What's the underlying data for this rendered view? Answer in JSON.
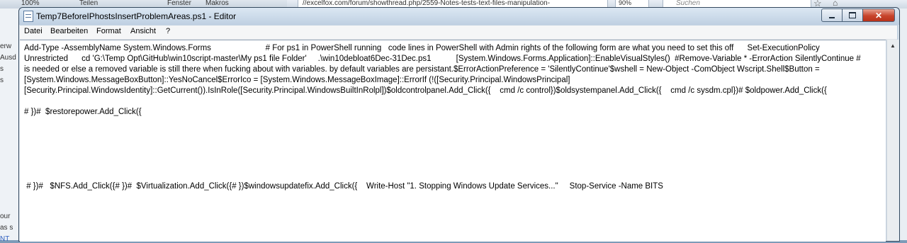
{
  "background": {
    "ribbon_items": [
      "100%",
      "Teilen",
      "Fenster",
      "Makros"
    ],
    "browser_url": "//excelfox.com/forum/showthread.php/2559-Notes-tests-text-files-manipulation-",
    "browser_zoom": "90%",
    "browser_search_placeholder": "Suchen",
    "left_snippets": [
      "Ausd",
      "erw",
      "s",
      "s",
      "our",
      "as s",
      "NT"
    ]
  },
  "window": {
    "title": "Temp7BeforeIPhostsInsertProblemAreas.ps1 - Editor"
  },
  "menu": {
    "items": [
      "Datei",
      "Bearbeiten",
      "Format",
      "Ansicht",
      "?"
    ]
  },
  "editor": {
    "content": "Add-Type -AssemblyName System.Windows.Forms                        # For ps1 in PowerShell running   code lines in PowerShell with Admin rights of the following form are what you need to set this off      Set-ExecutionPolicy Unrestricted      cd 'G:\\Temp Opt\\GitHub\\win10script-master\\My ps1 file Folder'     .\\win10debloat6Dec-31Dec.ps1           [System.Windows.Forms.Application]::EnableVisualStyles()  #Remove-Variable * -ErrorAction SilentlyContinue # is needed or else a removed variable is still there when fucking about with variables. by default variables are persistant.$ErrorActionPreference = 'SilentlyContinue'$wshell = New-Object -ComObject Wscript.Shell$Button = [System.Windows.MessageBoxButton]::YesNoCancel$ErrorIco = [System.Windows.MessageBoxImage]::ErrorIf (!([Security.Principal.WindowsPrincipal][Security.Principal.WindowsIdentity]::GetCurrent()).IsInRole([Security.Principal.WindowsBuiltInRolpl])$oldcontrolpanel.Add_Click({    cmd /c control})$oldsystempanel.Add_Click({    cmd /c sysdm.cpl})# $oldpower.Add_Click({\n\n# })#  $restorepower.Add_Click({\n\n\n\n\n\n\n # })#   $NFS.Add_Click({# })#  $Virtualization.Add_Click({# })$windowsupdatefix.Add_Click({    Write-Host \"1. Stopping Windows Update Services...\"     Stop-Service -Name BITS"
  }
}
